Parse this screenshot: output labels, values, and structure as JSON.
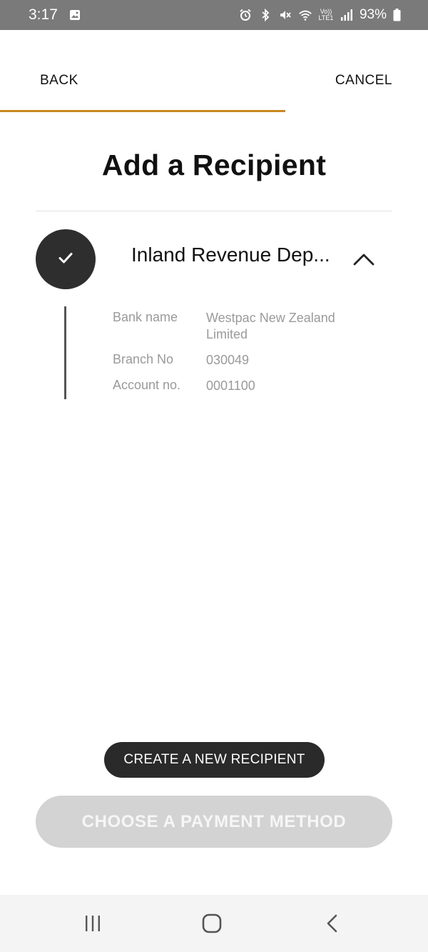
{
  "status_bar": {
    "time": "3:17",
    "battery_percent": "93%",
    "volte_label": "Vo))",
    "lte_label": "LTE1",
    "icons": [
      "gallery-icon",
      "alarm-icon",
      "bluetooth-icon",
      "mute-icon",
      "wifi-icon",
      "volte-icon",
      "signal-icon",
      "battery-icon"
    ]
  },
  "nav": {
    "back_label": "BACK",
    "cancel_label": "CANCEL"
  },
  "progress": {
    "value": 0.667,
    "color": "#c8891e"
  },
  "page": {
    "title": "Add a Recipient"
  },
  "recipient": {
    "avatar_icon": "check-icon",
    "name": "Inland Revenue Dep...",
    "expand_icon": "chevron-up-icon",
    "details": [
      {
        "label": "Bank name",
        "value": "Westpac New Zealand Limited"
      },
      {
        "label": "Branch No",
        "value": "030049"
      },
      {
        "label": "Account no.",
        "value": "0001100"
      }
    ]
  },
  "actions": {
    "create_label": "CREATE A NEW RECIPIENT",
    "choose_label": "CHOOSE A PAYMENT METHOD"
  },
  "system_nav": {
    "icons": [
      "recent-apps-icon",
      "home-icon",
      "back-icon"
    ]
  },
  "colors": {
    "accent": "#c8891e",
    "dark_button": "#2a2a2a",
    "disabled_button": "#d3d3d3"
  }
}
